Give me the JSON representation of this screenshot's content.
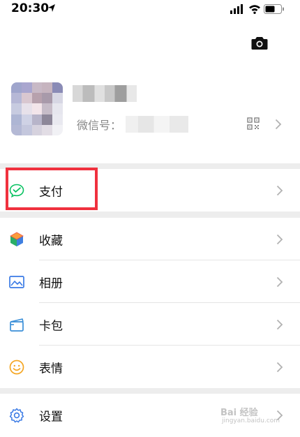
{
  "status_bar": {
    "time": "20:30",
    "icons": [
      "location-arrow-icon",
      "signal-icon",
      "wifi-icon",
      "battery-icon"
    ]
  },
  "profile": {
    "wechat_id_label": "微信号：",
    "actions": [
      "camera-icon",
      "qr-code-icon",
      "chevron-right-icon"
    ]
  },
  "menu": {
    "pay": {
      "label": "支付",
      "icon": "wechat-pay-icon"
    },
    "favorites": {
      "label": "收藏",
      "icon": "favorites-cube-icon"
    },
    "album": {
      "label": "相册",
      "icon": "photo-album-icon"
    },
    "cards": {
      "label": "卡包",
      "icon": "card-wallet-icon"
    },
    "stickers": {
      "label": "表情",
      "icon": "smiley-icon"
    },
    "settings": {
      "label": "设置",
      "icon": "gear-icon"
    }
  },
  "watermark": {
    "text": "Bai 经验",
    "sub": "jingyan.baidu.com"
  },
  "colors": {
    "highlight_border": "#f0313e",
    "pay_green": "#07c160",
    "background": "#ededed"
  }
}
